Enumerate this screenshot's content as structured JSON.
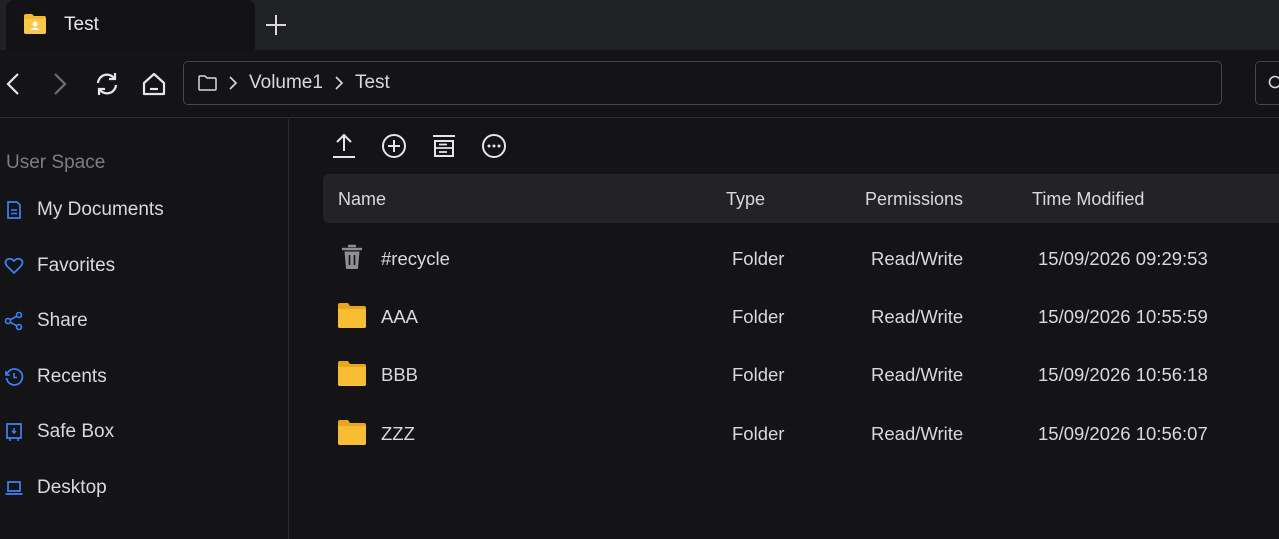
{
  "tab": {
    "title": "Test",
    "icon": "folder-user-icon"
  },
  "nav": {
    "back_icon": "chevron-left-icon",
    "forward_icon": "chevron-right-icon",
    "refresh_icon": "refresh-icon",
    "home_icon": "home-icon",
    "breadcrumb": [
      "Volume1",
      "Test"
    ]
  },
  "sidebar": {
    "heading": "User Space",
    "items": [
      {
        "label": "My Documents",
        "icon": "document-icon"
      },
      {
        "label": "Favorites",
        "icon": "heart-icon"
      },
      {
        "label": "Share",
        "icon": "share-icon"
      },
      {
        "label": "Recents",
        "icon": "clock-icon"
      },
      {
        "label": "Safe Box",
        "icon": "safe-box-icon"
      },
      {
        "label": "Desktop",
        "icon": "laptop-icon"
      }
    ]
  },
  "toolbar": [
    "upload-icon",
    "add-icon",
    "list-view-icon",
    "more-icon"
  ],
  "table": {
    "columns": [
      "Name",
      "Type",
      "Permissions",
      "Time Modified"
    ],
    "rows": [
      {
        "name": "#recycle",
        "type": "Folder",
        "permissions": "Read/Write",
        "modified": "15/09/2026 09:29:53",
        "icon": "trash-icon"
      },
      {
        "name": "AAA",
        "type": "Folder",
        "permissions": "Read/Write",
        "modified": "15/09/2026 10:55:59",
        "icon": "folder-icon"
      },
      {
        "name": "BBB",
        "type": "Folder",
        "permissions": "Read/Write",
        "modified": "15/09/2026 10:56:18",
        "icon": "folder-icon"
      },
      {
        "name": "ZZZ",
        "type": "Folder",
        "permissions": "Read/Write",
        "modified": "15/09/2026 10:56:07",
        "icon": "folder-icon"
      }
    ]
  },
  "colors": {
    "accent": "#3b82f6",
    "folder": "#f5b82e",
    "background": "#141416"
  }
}
